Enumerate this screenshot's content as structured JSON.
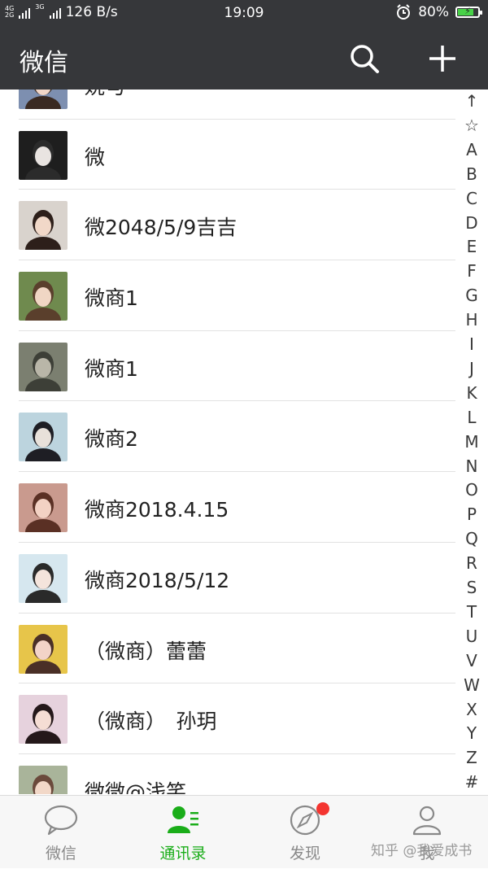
{
  "status_bar": {
    "network_top": "4G",
    "network_bottom": "2G",
    "network_3g": "3G",
    "speed": "126 B/s",
    "time": "19:09",
    "battery": "80%",
    "battery_level": 0.8
  },
  "header": {
    "title": "微信"
  },
  "contacts": [
    {
      "name": "姚勻",
      "avatar": "avatar-1"
    },
    {
      "name": "微",
      "avatar": "avatar-2"
    },
    {
      "name": "微2048/5/9吉吉",
      "avatar": "avatar-3"
    },
    {
      "name": "微商1",
      "avatar": "avatar-4"
    },
    {
      "name": "微商1",
      "avatar": "avatar-5"
    },
    {
      "name": "微商2",
      "avatar": "avatar-6"
    },
    {
      "name": "微商2018.4.15",
      "avatar": "avatar-7"
    },
    {
      "name": "微商2018/5/12",
      "avatar": "avatar-8"
    },
    {
      "name": "（微商）蕾蕾",
      "avatar": "avatar-9"
    },
    {
      "name": "（微商）　孙玥",
      "avatar": "avatar-10"
    },
    {
      "name": "微微@浅笑",
      "avatar": "avatar-11"
    }
  ],
  "index_letters": [
    "↑",
    "☆",
    "A",
    "B",
    "C",
    "D",
    "E",
    "F",
    "G",
    "H",
    "I",
    "J",
    "K",
    "L",
    "M",
    "N",
    "O",
    "P",
    "Q",
    "R",
    "S",
    "T",
    "U",
    "V",
    "W",
    "X",
    "Y",
    "Z",
    "#"
  ],
  "tabs": [
    {
      "label": "微信",
      "icon": "chat-bubble-icon",
      "active": false
    },
    {
      "label": "通讯录",
      "icon": "contacts-icon",
      "active": true
    },
    {
      "label": "发现",
      "icon": "compass-icon",
      "active": false,
      "badge": true
    },
    {
      "label": "我",
      "icon": "person-icon",
      "active": false
    }
  ],
  "watermark": "知乎 @我爱成书",
  "colors": {
    "header_bg": "#36373a",
    "active_green": "#1aad19",
    "badge_red": "#f43530"
  }
}
